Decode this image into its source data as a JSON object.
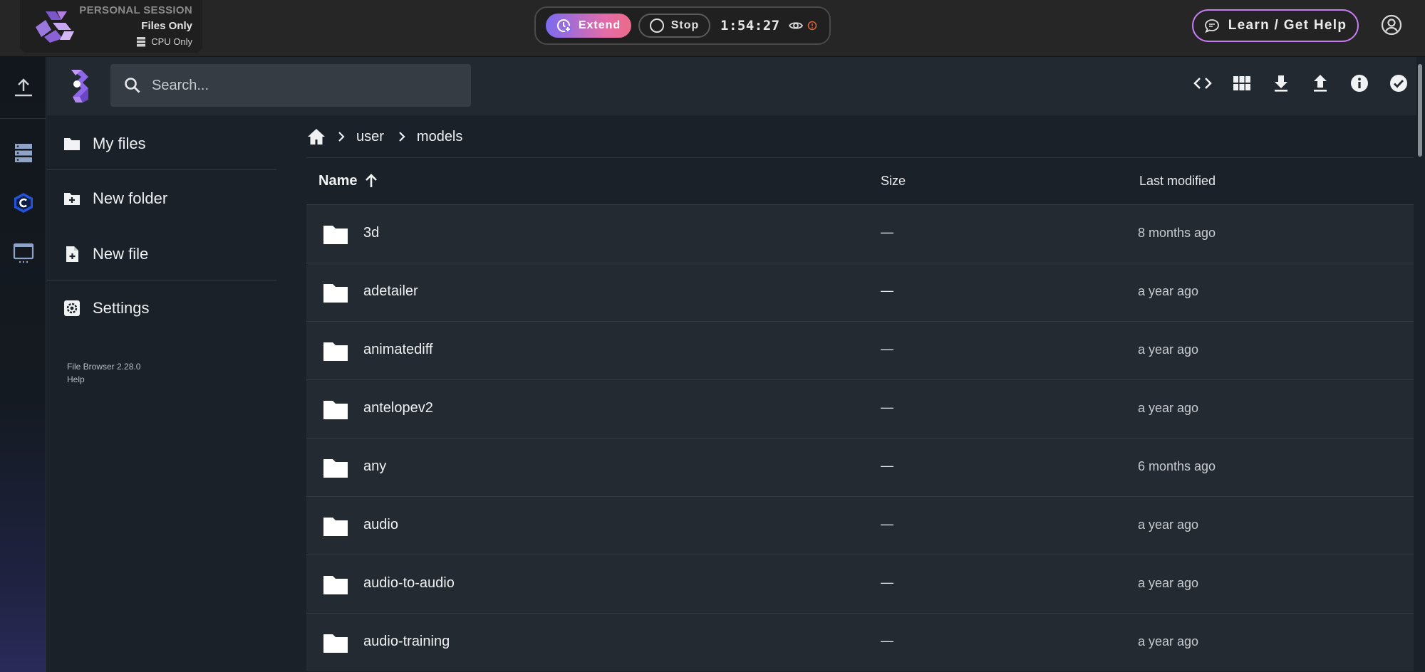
{
  "session": {
    "label": "PERSONAL SESSION",
    "mode": "Files Only",
    "hardware": "CPU Only",
    "icon": "server-icon"
  },
  "controls": {
    "extend_label": "Extend",
    "stop_label": "Stop",
    "timer": "1:54:27",
    "accent_gradient": [
      "#7b6cf0",
      "#ec6b8a"
    ]
  },
  "help": {
    "label": "Learn / Get Help",
    "border_color": "#c67cf2"
  },
  "search": {
    "placeholder": "Search...",
    "value": ""
  },
  "header_actions": [
    {
      "name": "code-view-icon"
    },
    {
      "name": "grid-view-icon"
    },
    {
      "name": "download-icon"
    },
    {
      "name": "upload-icon"
    },
    {
      "name": "info-icon"
    },
    {
      "name": "select-check-icon"
    }
  ],
  "sidebar": {
    "items": [
      {
        "label": "My files",
        "icon": "folder-icon"
      },
      {
        "label": "New folder",
        "icon": "create-folder-icon"
      },
      {
        "label": "New file",
        "icon": "note-add-icon"
      },
      {
        "label": "Settings",
        "icon": "settings-icon"
      }
    ],
    "version": "File Browser 2.28.0",
    "help": "Help"
  },
  "breadcrumb": {
    "segments": [
      "user",
      "models"
    ]
  },
  "table": {
    "columns": {
      "name": "Name",
      "size": "Size",
      "modified": "Last modified"
    },
    "sort": {
      "column": "name",
      "direction": "ascending"
    },
    "rows": [
      {
        "name": "3d",
        "size": "—",
        "modified": "8 months ago"
      },
      {
        "name": "adetailer",
        "size": "—",
        "modified": "a year ago"
      },
      {
        "name": "animatediff",
        "size": "—",
        "modified": "a year ago"
      },
      {
        "name": "antelopev2",
        "size": "—",
        "modified": "a year ago"
      },
      {
        "name": "any",
        "size": "—",
        "modified": "6 months ago"
      },
      {
        "name": "audio",
        "size": "—",
        "modified": "a year ago"
      },
      {
        "name": "audio-to-audio",
        "size": "—",
        "modified": "a year ago"
      },
      {
        "name": "audio-training",
        "size": "—",
        "modified": "a year ago"
      }
    ]
  },
  "colors": {
    "background": "#1b2128",
    "row": "#242a31",
    "header": "#222931",
    "topbar": "#262626"
  }
}
